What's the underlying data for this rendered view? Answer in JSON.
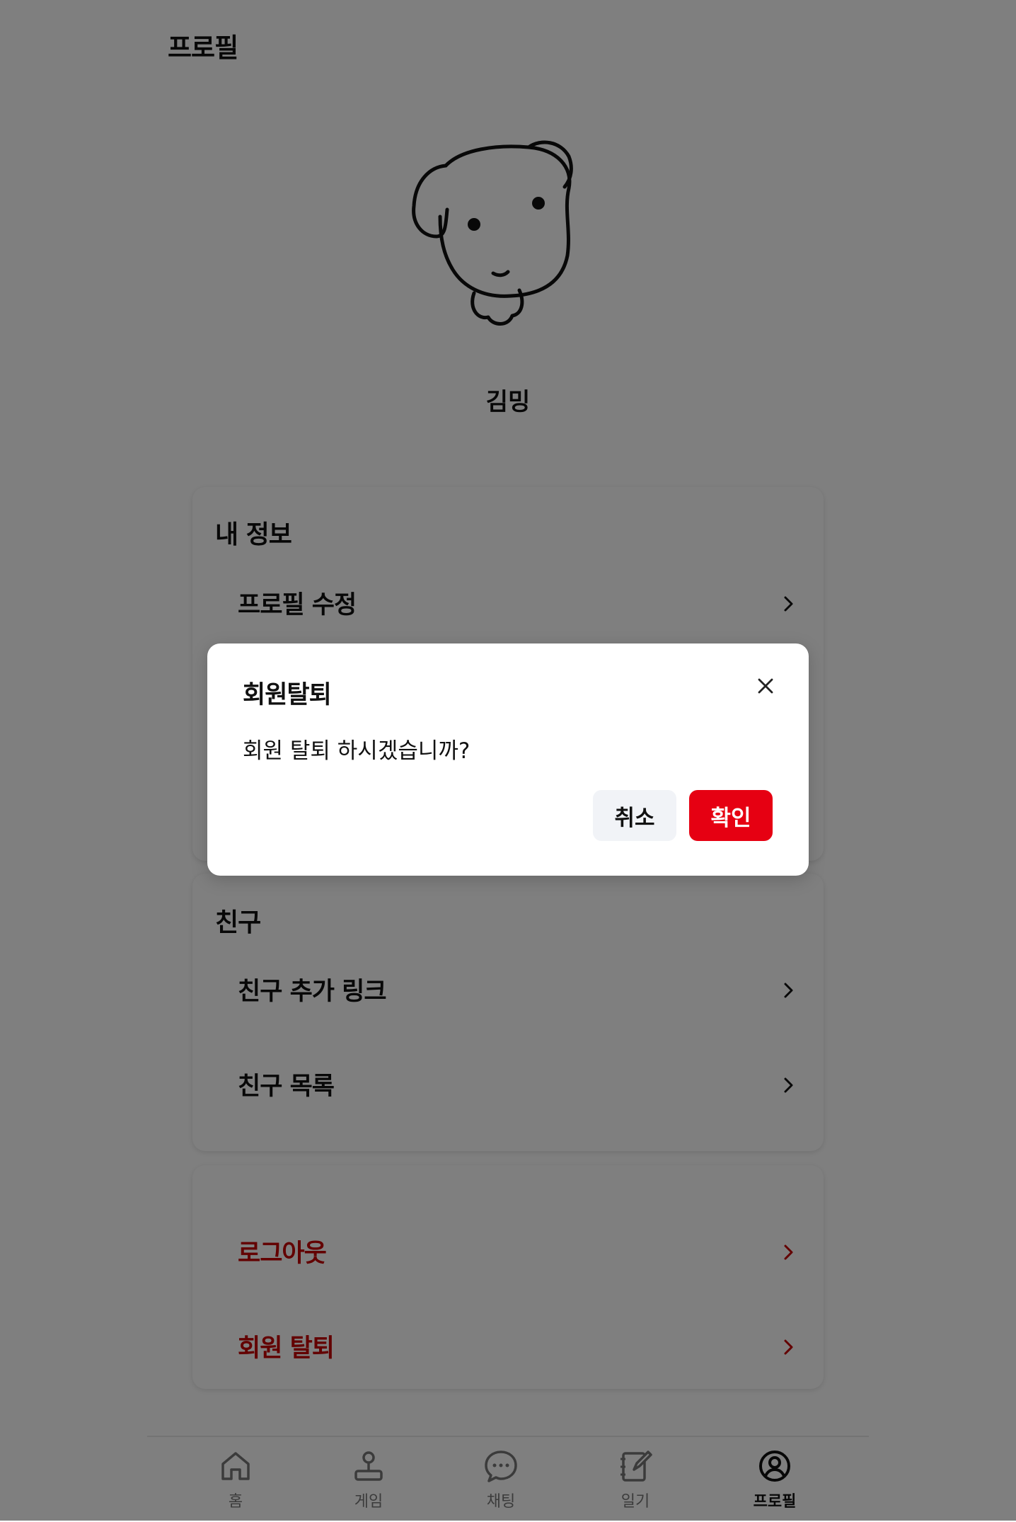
{
  "header": {
    "title": "프로필"
  },
  "profile": {
    "name": "김밍",
    "avatar_icon": "dog-avatar"
  },
  "sections": {
    "my_info": {
      "title": "내 정보",
      "items": [
        {
          "label": "프로필 수정"
        }
      ]
    },
    "friends": {
      "title": "친구",
      "items": [
        {
          "label": "친구 추가 링크"
        },
        {
          "label": "친구 목록"
        }
      ]
    },
    "account": {
      "items": [
        {
          "label": "로그아웃"
        },
        {
          "label": "회원 탈퇴"
        }
      ]
    }
  },
  "tabbar": {
    "tabs": [
      {
        "label": "홈",
        "icon": "home-icon"
      },
      {
        "label": "게임",
        "icon": "joystick-icon"
      },
      {
        "label": "채팅",
        "icon": "chat-bubble-icon"
      },
      {
        "label": "일기",
        "icon": "diary-icon"
      },
      {
        "label": "프로필",
        "icon": "user-circle-icon",
        "active": true
      }
    ]
  },
  "modal": {
    "title": "회원탈퇴",
    "message": "회원 탈퇴 하시겠습니까?",
    "cancel_label": "취소",
    "confirm_label": "확인"
  },
  "colors": {
    "danger_text": "#c70000",
    "confirm_button": "#e60012",
    "cancel_button": "#f1f3f7",
    "overlay": "rgba(0,0,0,0.5)"
  }
}
